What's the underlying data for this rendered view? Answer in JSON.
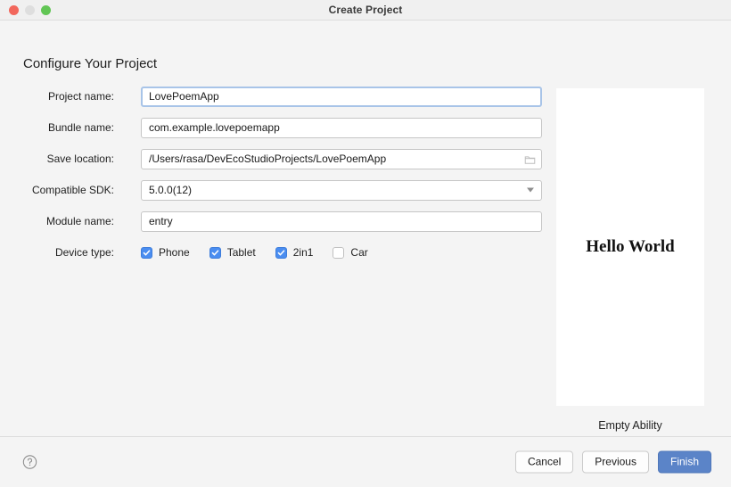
{
  "window": {
    "title": "Create Project",
    "traffic_lights": [
      {
        "name": "close",
        "color": "#f2675c"
      },
      {
        "name": "minimize",
        "color": "#dedede"
      },
      {
        "name": "zoom",
        "color": "#62c655"
      }
    ]
  },
  "heading": "Configure Your Project",
  "form": {
    "project_name": {
      "label": "Project name:",
      "value": "LovePoemApp",
      "placeholder": "Project name"
    },
    "bundle_name": {
      "label": "Bundle name:",
      "value": "com.example.lovepoemapp",
      "placeholder": "Bundle name"
    },
    "save_location": {
      "label": "Save location:",
      "value": "/Users/rasa/DevEcoStudioProjects/LovePoemApp",
      "placeholder": "Save location",
      "browse_icon": "folder-icon"
    },
    "compatible_sdk": {
      "label": "Compatible SDK:",
      "value": "5.0.0(12)",
      "arrow_icon": "chevron-down-icon"
    },
    "module_name": {
      "label": "Module name:",
      "value": "entry",
      "placeholder": "Module name"
    },
    "device_type": {
      "label": "Device type:",
      "options": [
        {
          "label": "Phone",
          "checked": true
        },
        {
          "label": "Tablet",
          "checked": true
        },
        {
          "label": "2in1",
          "checked": true
        },
        {
          "label": "Car",
          "checked": false
        }
      ]
    }
  },
  "preview": {
    "device_text": "Hello World",
    "caption": "Empty Ability"
  },
  "footer": {
    "help_icon": "help-circle-icon",
    "buttons": [
      {
        "label": "Cancel",
        "style": "secondary"
      },
      {
        "label": "Previous",
        "style": "secondary"
      },
      {
        "label": "Finish",
        "style": "primary"
      }
    ]
  },
  "colors": {
    "background": "#f4f4f4",
    "accent_checkbox": "#4a8df0",
    "accent_primary_button": "#5b84c8",
    "focus_border": "#a8c4e8"
  }
}
